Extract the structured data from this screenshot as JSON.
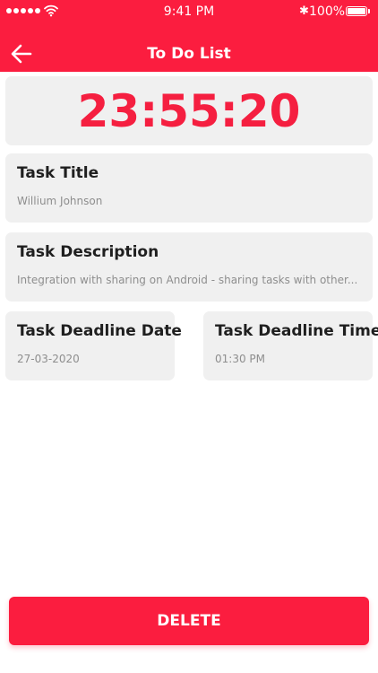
{
  "colors": {
    "accent": "#fb1d3f",
    "timer": "#f51f40",
    "card_background": "#f0f0f0",
    "muted_text": "#8e8e8e"
  },
  "status_bar": {
    "time": "9:41 PM",
    "battery": "100%",
    "icons": [
      "signal-dots",
      "wifi-icon",
      "bluetooth-icon",
      "battery-icon"
    ]
  },
  "header": {
    "title": "To Do List",
    "back_icon": "arrow-left-icon"
  },
  "timer": {
    "value": "23:55:20"
  },
  "task": {
    "title_label": "Task Title",
    "title_value": "Willium Johnson",
    "description_label": "Task Description",
    "description_value": "Integration with sharing on Android - sharing tasks with other...",
    "deadline_date_label": "Task Deadline Date",
    "deadline_date_value": "27-03-2020",
    "deadline_time_label": "Task Deadline Time",
    "deadline_time_value": "01:30 PM"
  },
  "actions": {
    "delete_label": "DELETE"
  }
}
